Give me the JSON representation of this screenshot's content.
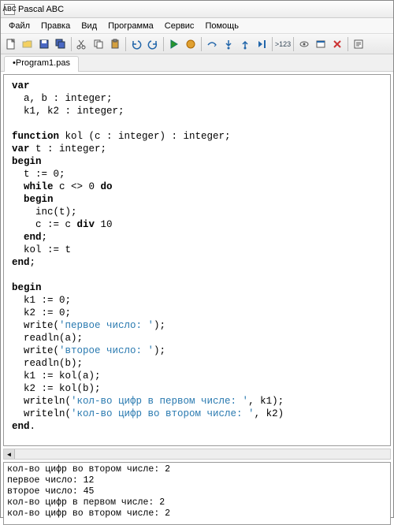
{
  "window": {
    "title": "Pascal ABC",
    "icon_label": "ABC"
  },
  "menu": {
    "items": [
      "Файл",
      "Правка",
      "Вид",
      "Программа",
      "Сервис",
      "Помощь"
    ]
  },
  "toolbar": {
    "icons": [
      "new-icon",
      "open-icon",
      "save-icon",
      "save-all-icon",
      "sep",
      "cut-icon",
      "copy-icon",
      "paste-icon",
      "sep",
      "undo-icon",
      "redo-icon",
      "sep",
      "run-icon",
      "stop-icon",
      "sep",
      "step-over-icon",
      "step-into-icon",
      "step-out-icon",
      "run-to-cursor-icon",
      "sep",
      "toggle-breakpoint-icon",
      "sep",
      "watch-icon",
      "output-window-icon",
      "close-output-icon",
      "sep",
      "help-icon"
    ],
    "run_label": ">123"
  },
  "tabs": {
    "active": "•Program1.pas"
  },
  "code": {
    "lines": [
      {
        "t": "kw",
        "s": "var"
      },
      {
        "t": "",
        "s": "  a, b : integer;"
      },
      {
        "t": "",
        "s": "  k1, k2 : integer;"
      },
      {
        "t": "",
        "s": ""
      },
      {
        "t": "mix",
        "parts": [
          {
            "t": "kw",
            "s": "function"
          },
          {
            "t": "",
            "s": " kol (c : integer) : integer;"
          }
        ]
      },
      {
        "t": "mix",
        "parts": [
          {
            "t": "kw",
            "s": "var"
          },
          {
            "t": "",
            "s": " t : integer;"
          }
        ]
      },
      {
        "t": "kw",
        "s": "begin"
      },
      {
        "t": "",
        "s": "  t := 0;"
      },
      {
        "t": "mix",
        "parts": [
          {
            "t": "",
            "s": "  "
          },
          {
            "t": "kw",
            "s": "while"
          },
          {
            "t": "",
            "s": " c <> 0 "
          },
          {
            "t": "kw",
            "s": "do"
          }
        ]
      },
      {
        "t": "mix",
        "parts": [
          {
            "t": "",
            "s": "  "
          },
          {
            "t": "kw",
            "s": "begin"
          }
        ]
      },
      {
        "t": "",
        "s": "    inc(t);"
      },
      {
        "t": "mix",
        "parts": [
          {
            "t": "",
            "s": "    c := c "
          },
          {
            "t": "kw",
            "s": "div"
          },
          {
            "t": "",
            "s": " 10"
          }
        ]
      },
      {
        "t": "mix",
        "parts": [
          {
            "t": "",
            "s": "  "
          },
          {
            "t": "kw",
            "s": "end"
          },
          {
            "t": "",
            "s": ";"
          }
        ]
      },
      {
        "t": "",
        "s": "  kol := t"
      },
      {
        "t": "mix",
        "parts": [
          {
            "t": "kw",
            "s": "end"
          },
          {
            "t": "",
            "s": ";"
          }
        ]
      },
      {
        "t": "",
        "s": ""
      },
      {
        "t": "kw",
        "s": "begin"
      },
      {
        "t": "",
        "s": "  k1 := 0;"
      },
      {
        "t": "",
        "s": "  k2 := 0;"
      },
      {
        "t": "mix",
        "parts": [
          {
            "t": "",
            "s": "  write("
          },
          {
            "t": "str",
            "s": "'первое число: '"
          },
          {
            "t": "",
            "s": ");"
          }
        ]
      },
      {
        "t": "",
        "s": "  readln(a);"
      },
      {
        "t": "mix",
        "parts": [
          {
            "t": "",
            "s": "  write("
          },
          {
            "t": "str",
            "s": "'второе число: '"
          },
          {
            "t": "",
            "s": ");"
          }
        ]
      },
      {
        "t": "",
        "s": "  readln(b);"
      },
      {
        "t": "",
        "s": "  k1 := kol(a);"
      },
      {
        "t": "",
        "s": "  k2 := kol(b);"
      },
      {
        "t": "mix",
        "parts": [
          {
            "t": "",
            "s": "  writeln("
          },
          {
            "t": "str",
            "s": "'кол-во цифр в первом числе: '"
          },
          {
            "t": "",
            "s": ", k1);"
          }
        ]
      },
      {
        "t": "mix",
        "parts": [
          {
            "t": "",
            "s": "  writeln("
          },
          {
            "t": "str",
            "s": "'кол-во цифр во втором числе: '"
          },
          {
            "t": "",
            "s": ", k2)"
          }
        ]
      },
      {
        "t": "mix",
        "parts": [
          {
            "t": "kw",
            "s": "end"
          },
          {
            "t": "",
            "s": "."
          }
        ]
      }
    ]
  },
  "output": {
    "lines": [
      "кол-во цифр во втором числе: 2",
      "первое число: 12",
      "второе число: 45",
      "кол-во цифр в первом числе: 2",
      "кол-во цифр во втором числе: 2"
    ]
  }
}
